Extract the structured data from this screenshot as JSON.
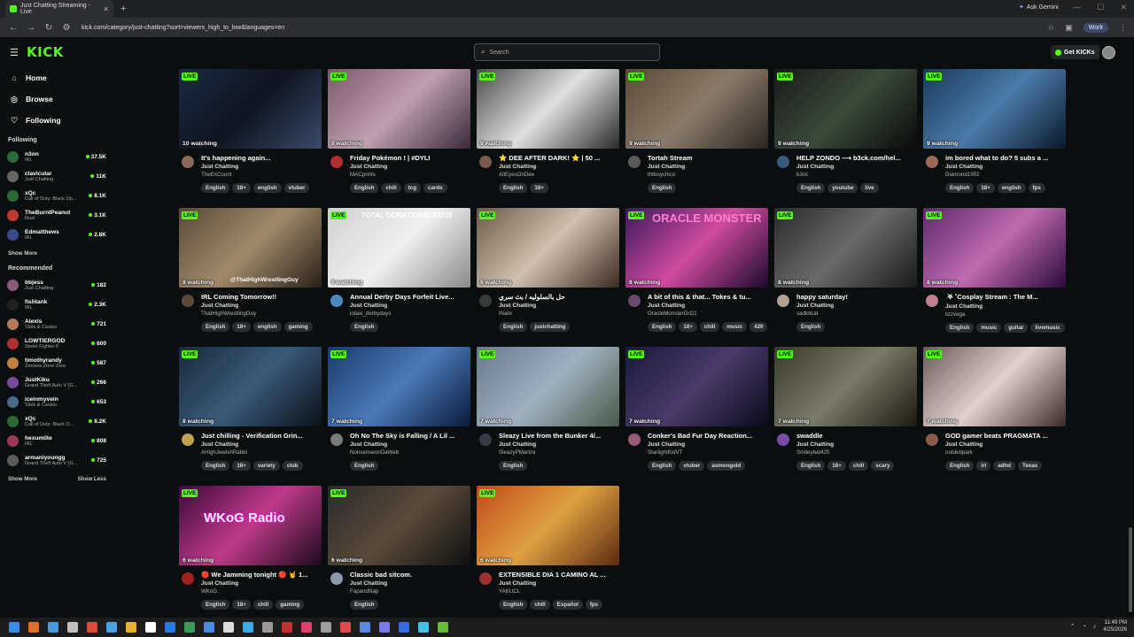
{
  "browser": {
    "tab_title": "Just Chatting Streaming - Live",
    "url": "kick.com/category/just-chatting?sort=viewers_high_to_low&languages=en",
    "ask_gemini": "Ask Gemini",
    "profile": "Work"
  },
  "header": {
    "logo": "KICK",
    "search_placeholder": "Search",
    "get_kicks": "Get KICKs"
  },
  "sidebar": {
    "nav": [
      {
        "label": "Home",
        "icon": "home-icon"
      },
      {
        "label": "Browse",
        "icon": "compass-icon"
      },
      {
        "label": "Following",
        "icon": "heart-icon"
      }
    ],
    "following_title": "Following",
    "following": [
      {
        "name": "n3on",
        "category": "IRL",
        "viewers": "37.5K",
        "color": "#2d6a3a"
      },
      {
        "name": "clavicular",
        "category": "Just Chatting",
        "viewers": "11K",
        "color": "#666666"
      },
      {
        "name": "xQc",
        "category": "Call of Duty: Black Op...",
        "viewers": "8.1K",
        "color": "#2a6b35"
      },
      {
        "name": "TheBurntPeanut",
        "category": "Rust",
        "viewers": "3.1K",
        "color": "#c0392b"
      },
      {
        "name": "Edmatthews",
        "category": "IRL",
        "viewers": "2.8K",
        "color": "#3a4a8a"
      }
    ],
    "show_more": "Show More",
    "recommended_title": "Recommended",
    "recommended": [
      {
        "name": "bbjess",
        "category": "Just Chatting",
        "viewers": "182",
        "color": "#8a5a7a"
      },
      {
        "name": "fishtank",
        "category": "IRL",
        "viewers": "2.3K",
        "color": "#222222"
      },
      {
        "name": "Alexis",
        "category": "Slots & Casino",
        "viewers": "721",
        "color": "#b07a5a"
      },
      {
        "name": "LOWTIERGOD",
        "category": "Street Fighter 6",
        "viewers": "600",
        "color": "#b03030"
      },
      {
        "name": "timothyrandy",
        "category": "Zenless Zone Zero",
        "viewers": "587",
        "color": "#c08040"
      },
      {
        "name": "JustKiku",
        "category": "Grand Theft Auto V (G...",
        "viewers": "266",
        "color": "#7a4a9a"
      },
      {
        "name": "iceinmyvein",
        "category": "Slots & Casino",
        "viewers": "653",
        "color": "#4a6a8a"
      },
      {
        "name": "xQc",
        "category": "Call of Duty: Black O...",
        "viewers": "8.2K",
        "color": "#2a6b35"
      },
      {
        "name": "hexumlite",
        "category": "IRL",
        "viewers": "808",
        "color": "#9a3a5a"
      },
      {
        "name": "armaniyoungg",
        "category": "Grand Theft Auto V (G...",
        "viewers": "725",
        "color": "#5a5a5a"
      }
    ],
    "show_more_2": "Show More",
    "show_less": "Show Less"
  },
  "streams": [
    {
      "title": "It's happening again...",
      "category": "Just Chatting",
      "streamer": "TheExCount",
      "watching": "10 watching",
      "tags": [
        "English",
        "18+",
        "english",
        "vtuber"
      ],
      "thumb": [
        "#1c2a44",
        "#0e1420",
        "#3a4a6a"
      ],
      "avatar": "#8a6a5a"
    },
    {
      "title": "Friday Pokémon ! | #DYLI",
      "category": "Just Chatting",
      "streamer": "MACprints",
      "watching": "9 watching",
      "tags": [
        "English",
        "chill",
        "tcg",
        "cards"
      ],
      "thumb": [
        "#7a5a6a",
        "#c0a0b0",
        "#3a2a3a"
      ],
      "avatar": "#b03030"
    },
    {
      "title": "⭐ DEE AFTER DARK! ⭐ | 50 ...",
      "category": "Just Chatting",
      "streamer": "AllEyesOnDee",
      "watching": "9 watching",
      "tags": [
        "English",
        "18+"
      ],
      "thumb": [
        "#4a4a4a",
        "#e0e0e0",
        "#2a2a2a"
      ],
      "avatar": "#7a5a4a"
    },
    {
      "title": "Tortah Stream",
      "category": "Just Chatting",
      "streamer": "thtboychico",
      "watching": "9 watching",
      "tags": [
        "English"
      ],
      "thumb": [
        "#5a4a3a",
        "#8a7a6a",
        "#2a2420"
      ],
      "avatar": "#5a5a5a"
    },
    {
      "title": "HELP ZONDO ⟶ b3ck.com/hel...",
      "category": "Just Chatting",
      "streamer": "b3ck",
      "watching": "9 watching",
      "tags": [
        "English",
        "youtube",
        "live"
      ],
      "thumb": [
        "#1a1a1a",
        "#3a4a3a",
        "#0a0a0a"
      ],
      "avatar": "#3a5a7a"
    },
    {
      "title": "im bored what to do? 5 subs a ...",
      "category": "Just Chatting",
      "streamer": "Diamond1992",
      "watching": "9 watching",
      "tags": [
        "English",
        "18+",
        "english",
        "fps"
      ],
      "thumb": [
        "#1a3a5a",
        "#4a7aaa",
        "#0a1a2a"
      ],
      "avatar": "#9a6a5a"
    },
    {
      "title": "IRL Coming Tomorrow!!",
      "category": "Just Chatting",
      "streamer": "ThatHighWrestlingGuy",
      "watching": "9 watching",
      "tags": [
        "English",
        "18+",
        "english",
        "gaming"
      ],
      "thumb": [
        "#5a4a3a",
        "#a08a6a",
        "#2a2018"
      ],
      "avatar": "#5a4a3a",
      "overlay": "@ThatHighWrestlingGuy"
    },
    {
      "title": "Annual Derby Days Forfeit Live...",
      "category": "Just Chatting",
      "streamer": "iotaxi_derbydays",
      "watching": "9 watching",
      "tags": [
        "English"
      ],
      "thumb": [
        "#d0d0d0",
        "#f0f0f0",
        "#8a8a8a"
      ],
      "avatar": "#4a8ac0",
      "overlay": "TOTAL DONATIONS: $3216"
    },
    {
      "title": "حل بالسلوليه / بث سري",
      "category": "Just Chatting",
      "streamer": "iNalix",
      "watching": "8 watching",
      "tags": [
        "English",
        "justchatting"
      ],
      "thumb": [
        "#6a5a4a",
        "#d0c0b0",
        "#3a2a20"
      ],
      "avatar": "#3a3a3a"
    },
    {
      "title": "A bit of this & that... Tokes & tu...",
      "category": "Just Chatting",
      "streamer": "OracleMonsterGrl21",
      "watching": "8 watching",
      "tags": [
        "English",
        "18+",
        "chill",
        "music",
        "420"
      ],
      "thumb": [
        "#3a1a5a",
        "#d04aa0",
        "#1a0a2a"
      ],
      "avatar": "#6a4a6a",
      "overlay": "ORACLE MONSTER"
    },
    {
      "title": "happy saturday!",
      "category": "Just Chatting",
      "streamer": "sadkitcat",
      "watching": "8 watching",
      "tags": [
        "English"
      ],
      "thumb": [
        "#2a2a2a",
        "#6a6a6a",
        "#1a1a1a"
      ],
      "avatar": "#b0a090"
    },
    {
      "title": "ִ ࣪𖤐 ˚Cosplay Stream : The M...",
      "category": "Just Chatting",
      "streamer": "lizzvega",
      "watching": "8 watching",
      "tags": [
        "English",
        "music",
        "guitar",
        "livemusic"
      ],
      "thumb": [
        "#5a2a6a",
        "#c06ab0",
        "#2a0a3a"
      ],
      "avatar": "#c08090"
    },
    {
      "title": "Just chilling - Verification Grin...",
      "category": "Just Chatting",
      "streamer": "AHighJewishRabbi",
      "watching": "8 watching",
      "tags": [
        "English",
        "18+",
        "variety",
        "club"
      ],
      "thumb": [
        "#1a2a3a",
        "#3a5a7a",
        "#0a1018"
      ],
      "avatar": "#c0a050"
    },
    {
      "title": "Oh No The Sky is Falling / A Lil ...",
      "category": "Just Chatting",
      "streamer": "NonsenseonDaWeb",
      "watching": "7 watching",
      "tags": [
        "English"
      ],
      "thumb": [
        "#1a3a6a",
        "#4a7aba",
        "#0a1a3a"
      ],
      "avatar": "#7a7a7a"
    },
    {
      "title": "Sleazy Live from the Bunker 4/...",
      "category": "Just Chatting",
      "streamer": "SleazyPMartini",
      "watching": "7 watching",
      "tags": [
        "English"
      ],
      "thumb": [
        "#6a7a8a",
        "#a0b0c0",
        "#4a5a4a"
      ],
      "avatar": "#3a3a4a"
    },
    {
      "title": "Conker's Bad Fur Day Reaction...",
      "category": "Just Chatting",
      "streamer": "StarlightKidVT",
      "watching": "7 watching",
      "tags": [
        "English",
        "vtuber",
        "asmongold"
      ],
      "thumb": [
        "#1a1a3a",
        "#4a3a6a",
        "#0a0a1a"
      ],
      "avatar": "#9a5a7a"
    },
    {
      "title": "swaddle",
      "category": "Just Chatting",
      "streamer": "Smileybat420",
      "watching": "7 watching",
      "tags": [
        "English",
        "18+",
        "chill",
        "scary"
      ],
      "thumb": [
        "#3a3a2a",
        "#7a7a6a",
        "#1a1a10"
      ],
      "avatar": "#7a4aaa"
    },
    {
      "title": "GOD gamer beats PRAGMATA ...",
      "category": "Just Chatting",
      "streamer": "notdebpark",
      "watching": "7 watching",
      "tags": [
        "English",
        "irl",
        "adhd",
        "Texas"
      ],
      "thumb": [
        "#6a5a5a",
        "#e0d0d0",
        "#3a2a2a"
      ],
      "avatar": "#8a5a4a"
    },
    {
      "title": "🔴 We Jamming tonight 🔴 🤘 1...",
      "category": "Just Chatting",
      "streamer": "WKoG",
      "watching": "6 watching",
      "tags": [
        "English",
        "18+",
        "chill",
        "gaming"
      ],
      "thumb": [
        "#3a0a3a",
        "#c03a8a",
        "#1a0a1a"
      ],
      "avatar": "#a02020",
      "overlay": "WKoG Radio"
    },
    {
      "title": "Classic bad sitcom.",
      "category": "Just Chatting",
      "streamer": "FapandNap",
      "watching": "6 watching",
      "tags": [
        "English"
      ],
      "thumb": [
        "#2a2a2a",
        "#5a4a3a",
        "#101010"
      ],
      "avatar": "#8a9aaa"
    },
    {
      "title": "EXTENSIBLE DIA 1 CAMINO AL ...",
      "category": "Just Chatting",
      "streamer": "YAKUCL",
      "watching": "6 watching",
      "tags": [
        "English",
        "chill",
        "Español",
        "fps"
      ],
      "thumb": [
        "#c04a1a",
        "#e0a040",
        "#5a2a10"
      ],
      "avatar": "#a03030"
    }
  ],
  "clock": {
    "time": "11:49 PM",
    "date": "4/25/2026"
  }
}
